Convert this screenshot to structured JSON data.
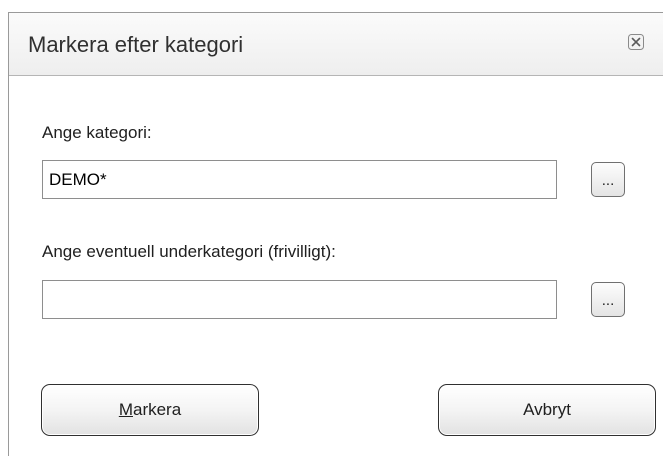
{
  "dialog": {
    "title": "Markera efter kategori",
    "close_icon": "close-icon"
  },
  "category": {
    "label": "Ange kategori:",
    "value": "DEMO*",
    "browse_label": "..."
  },
  "subcategory": {
    "label": "Ange eventuell underkategori (frivilligt):",
    "value": "",
    "browse_label": "..."
  },
  "buttons": {
    "mark_accel": "M",
    "mark_rest": "arkera",
    "cancel_label": "Avbryt"
  },
  "colors": {
    "title_bar": "#f5f5f5",
    "content_bg": "#ffffff",
    "button_border": "#303030"
  }
}
